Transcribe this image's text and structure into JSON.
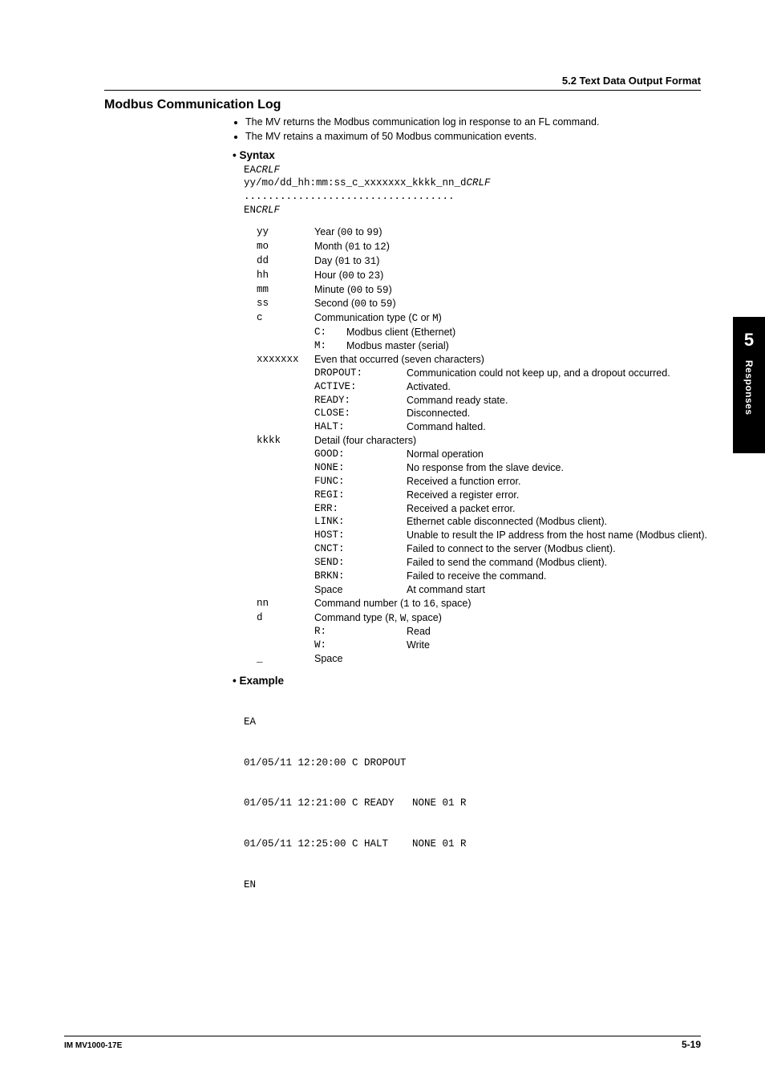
{
  "header": {
    "section_label": "5.2  Text Data Output Format"
  },
  "sidebar": {
    "chapter": "5",
    "label": "Responses"
  },
  "title": "Modbus Communication Log",
  "intro_bullets": [
    "The MV returns the Modbus communication log in response to an FL command.",
    "The MV retains a maximum of 50 Modbus communication events."
  ],
  "syntax": {
    "heading": "Syntax",
    "lines": {
      "l1a": "EA",
      "l1b": "CRLF",
      "l2a": "yy/mo/dd_hh:mm:ss_c_xxxxxxx_kkkk_nn_d",
      "l2b": "CRLF",
      "l3": "...................................",
      "l4a": "EN",
      "l4b": "CRLF"
    }
  },
  "defs": {
    "yy": {
      "k": "yy",
      "pre": "Year (",
      "a": "00",
      "mid": " to ",
      "b": "99",
      "post": ")"
    },
    "mo": {
      "k": "mo",
      "pre": "Month (",
      "a": "01",
      "mid": " to ",
      "b": "12",
      "post": ")"
    },
    "dd": {
      "k": "dd",
      "pre": "Day (",
      "a": "01",
      "mid": " to ",
      "b": "31",
      "post": ")"
    },
    "hh": {
      "k": "hh",
      "pre": "Hour (",
      "a": "00",
      "mid": " to ",
      "b": "23",
      "post": ")"
    },
    "mm": {
      "k": "mm",
      "pre": "Minute (",
      "a": "00",
      "mid": " to ",
      "b": "59",
      "post": ")"
    },
    "ss": {
      "k": "ss",
      "pre": "Second (",
      "a": "00",
      "mid": " to ",
      "b": "59",
      "post": ")"
    },
    "c": {
      "k": "c",
      "pre": "Communication type (",
      "a": "C",
      "mid": " or ",
      "b": "M",
      "post": ")",
      "sub": [
        {
          "k": "C:",
          "v": "Modbus client (Ethernet)"
        },
        {
          "k": "M:",
          "v": "Modbus master (serial)"
        }
      ]
    },
    "xxxxxxx": {
      "k": "xxxxxxx",
      "label": "Even that occurred (seven characters)",
      "sub": [
        {
          "k": "DROPOUT:",
          "v": "Communication could not keep up, and a dropout occurred."
        },
        {
          "k": "ACTIVE:",
          "v": "Activated."
        },
        {
          "k": "READY:",
          "v": "Command ready state."
        },
        {
          "k": "CLOSE:",
          "v": "Disconnected."
        },
        {
          "k": "HALT:",
          "v": "Command halted."
        }
      ]
    },
    "kkkk": {
      "k": "kkkk",
      "label": "Detail (four characters)",
      "sub": [
        {
          "k": "GOOD:",
          "v": "Normal operation"
        },
        {
          "k": "NONE:",
          "v": "No response from the slave device."
        },
        {
          "k": "FUNC:",
          "v": "Received a function error."
        },
        {
          "k": "REGI:",
          "v": "Received a register error."
        },
        {
          "k": "ERR:",
          "v": "Received a packet error."
        },
        {
          "k": "LINK:",
          "v": "Ethernet cable disconnected (Modbus client)."
        },
        {
          "k": "HOST:",
          "v": "Unable to result the IP address from the host name (Modbus client)."
        },
        {
          "k": "CNCT:",
          "v": "Failed to connect to the server (Modbus client)."
        },
        {
          "k": "SEND:",
          "v": "Failed to send the command (Modbus client)."
        },
        {
          "k": "BRKN:",
          "v": "Failed to receive the command."
        },
        {
          "k": "Space",
          "v": "At command start",
          "plain": true
        }
      ]
    },
    "nn": {
      "k": "nn",
      "pre": "Command number (",
      "a": "1",
      "mid": " to ",
      "b": "16",
      "post": ", space)"
    },
    "d": {
      "k": "d",
      "pre": "Command type (",
      "a": "R",
      "mid": ", ",
      "b": "W",
      "post": ", space)",
      "sub": [
        {
          "k": "R:",
          "v": "Read"
        },
        {
          "k": "W:",
          "v": "Write"
        }
      ]
    },
    "underscore": {
      "k": "_",
      "label": "Space"
    }
  },
  "example": {
    "heading": "Example",
    "lines": [
      "EA",
      "01/05/11 12:20:00 C DROPOUT",
      "01/05/11 12:21:00 C READY   NONE 01 R",
      "01/05/11 12:25:00 C HALT    NONE 01 R",
      "EN"
    ]
  },
  "footer": {
    "left": "IM MV1000-17E",
    "right": "5-19"
  }
}
